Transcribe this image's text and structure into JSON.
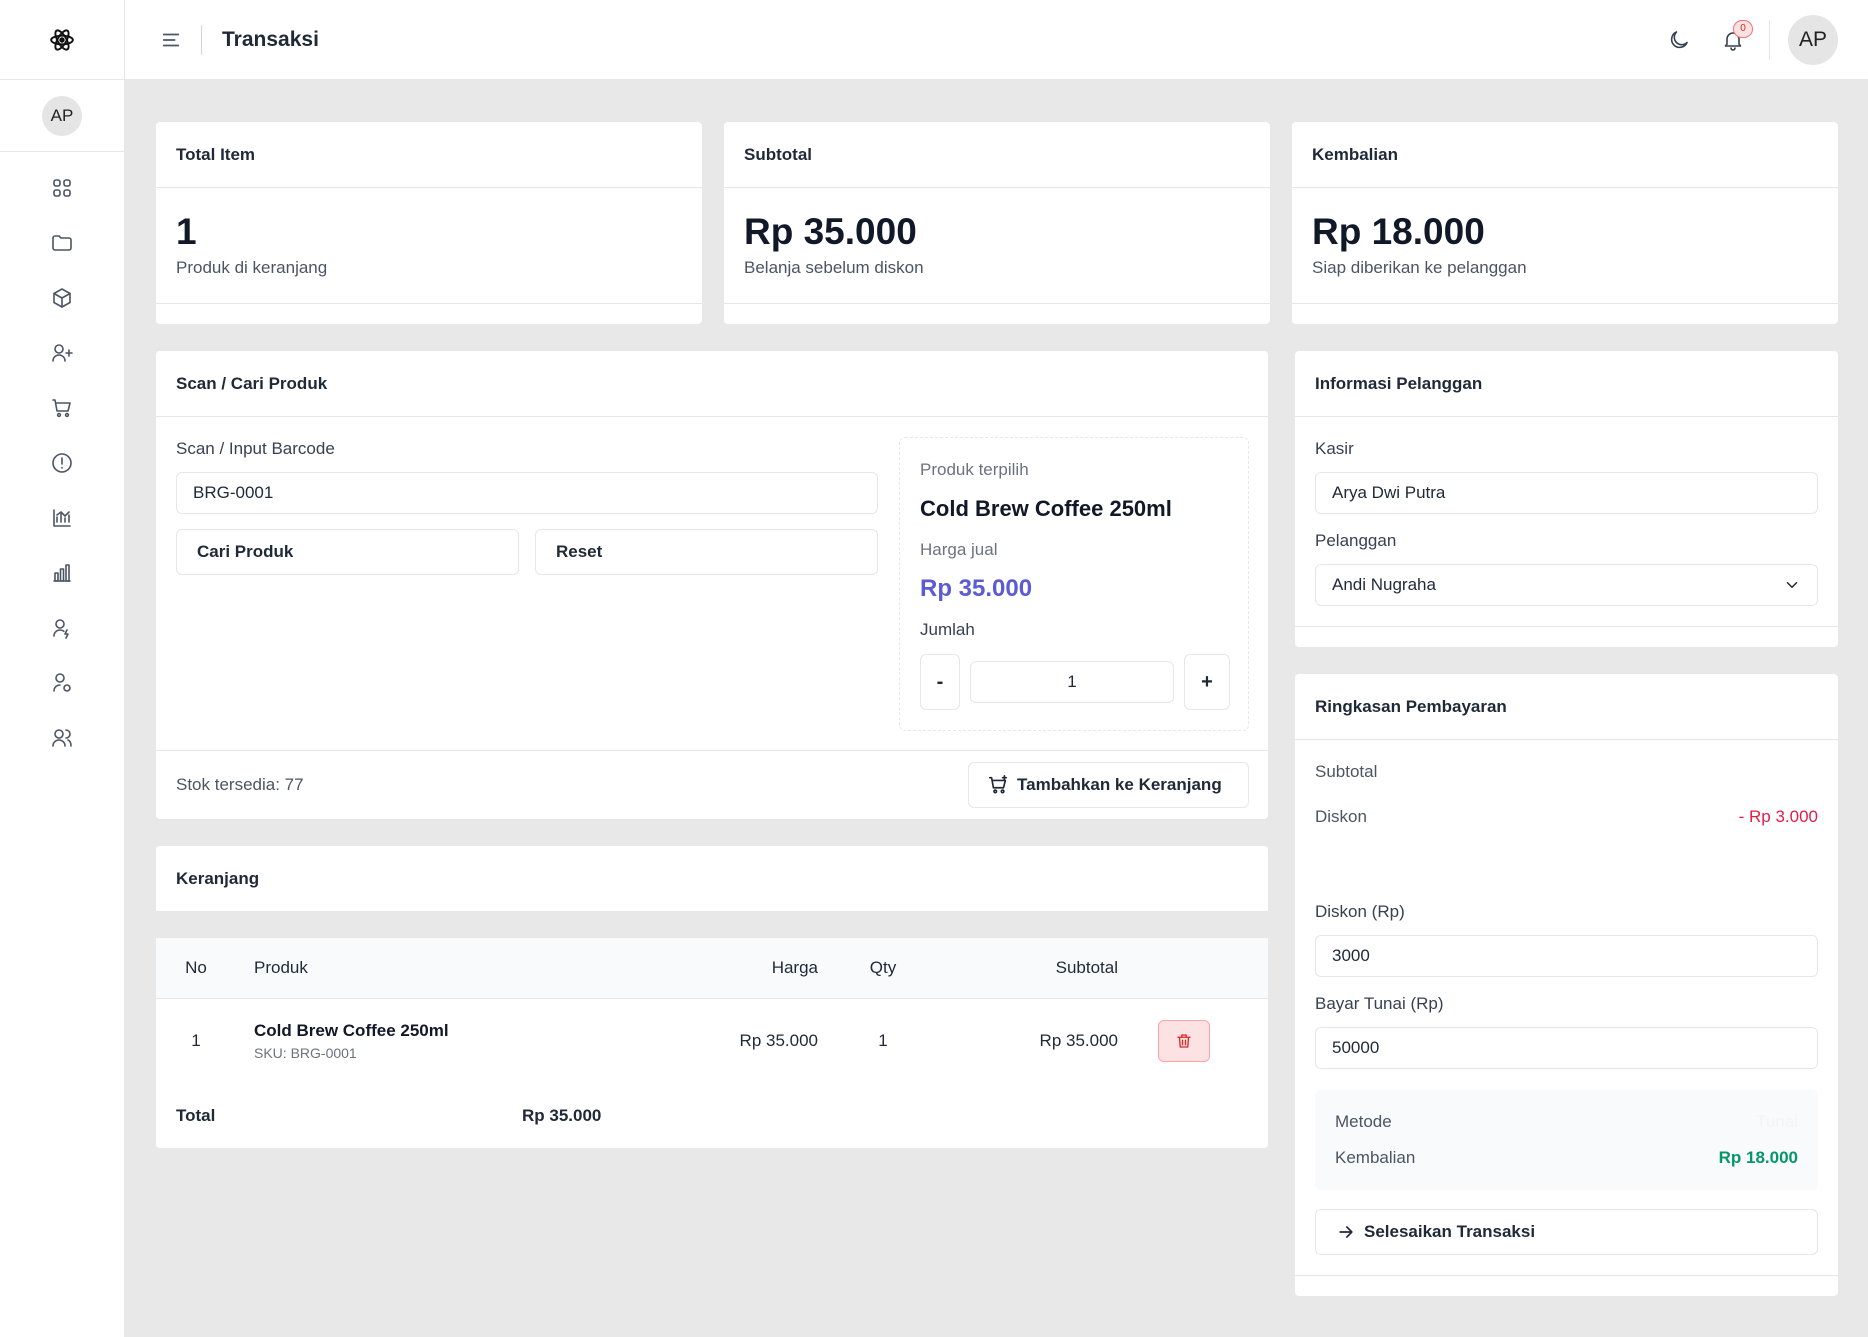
{
  "header": {
    "title": "Transaksi",
    "notification_count": "0",
    "user_initials": "AP"
  },
  "sidebar": {
    "user_initials": "AP",
    "items": [
      {
        "icon": "grid-icon"
      },
      {
        "icon": "folder-icon"
      },
      {
        "icon": "box-icon"
      },
      {
        "icon": "user-plus-icon"
      },
      {
        "icon": "cart-icon"
      },
      {
        "icon": "alert-circle-icon"
      },
      {
        "icon": "chart-line-icon"
      },
      {
        "icon": "bar-chart-icon"
      },
      {
        "icon": "user-edit-icon"
      },
      {
        "icon": "user-settings-icon"
      },
      {
        "icon": "users-icon"
      }
    ]
  },
  "stats": {
    "total_item": {
      "title": "Total Item",
      "value": "1",
      "sub": "Produk di keranjang"
    },
    "subtotal": {
      "title": "Subtotal",
      "value": "Rp 35.000",
      "sub": "Belanja sebelum diskon"
    },
    "kembalian": {
      "title": "Kembalian",
      "value": "Rp 18.000",
      "sub": "Siap diberikan ke pelanggan"
    }
  },
  "scan": {
    "title": "Scan / Cari Produk",
    "barcode_label": "Scan / Input Barcode",
    "barcode_value": "BRG-0001",
    "search_button": "Cari Produk",
    "reset_button": "Reset",
    "selected_label": "Produk terpilih",
    "selected_name": "Cold Brew Coffee 250ml",
    "price_label": "Harga jual",
    "price_value": "Rp 35.000",
    "qty_label": "Jumlah",
    "qty_minus": "-",
    "qty_value": "1",
    "qty_plus": "+",
    "stock_text": "Stok tersedia: 77",
    "add_button": "Tambahkan ke Keranjang"
  },
  "cart": {
    "title": "Keranjang",
    "columns": {
      "no": "No",
      "produk": "Produk",
      "harga": "Harga",
      "qty": "Qty",
      "subtotal": "Subtotal"
    },
    "rows": [
      {
        "no": "1",
        "name": "Cold Brew Coffee 250ml",
        "sku": "SKU: BRG-0001",
        "harga": "Rp 35.000",
        "qty": "1",
        "subtotal": "Rp 35.000"
      }
    ],
    "total_label": "Total",
    "total_value": "Rp 35.000"
  },
  "customer": {
    "title": "Informasi Pelanggan",
    "kasir_label": "Kasir",
    "kasir_value": "Arya Dwi Putra",
    "pelanggan_label": "Pelanggan",
    "pelanggan_value": "Andi Nugraha"
  },
  "payment": {
    "title": "Ringkasan Pembayaran",
    "subtotal_label": "Subtotal",
    "diskon_label": "Diskon",
    "diskon_value": "- Rp 3.000",
    "diskon_input_label": "Diskon (Rp)",
    "diskon_input_value": "3000",
    "bayar_label": "Bayar Tunai (Rp)",
    "bayar_value": "50000",
    "metode_label": "Metode",
    "metode_value": "Tunai",
    "kembalian_label": "Kembalian",
    "kembalian_value": "Rp 18.000",
    "finish_button": "Selesaikan Transaksi"
  },
  "colors": {
    "accent": "#5b5bd6",
    "danger": "#e11d48",
    "success": "#059669"
  }
}
